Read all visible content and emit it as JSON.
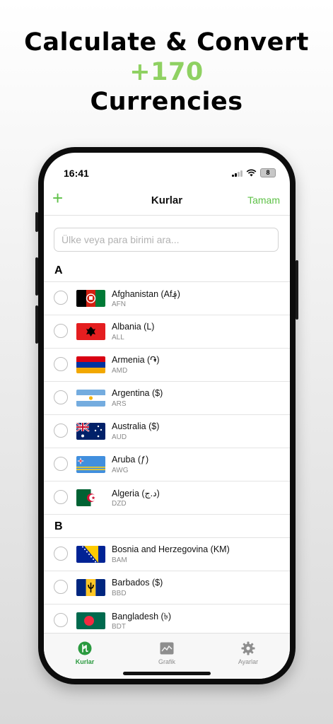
{
  "promo": {
    "line1": "Calculate & Convert",
    "line2": "+170",
    "line3": "Currencies"
  },
  "status": {
    "time": "16:41",
    "battery": "8"
  },
  "nav": {
    "add": "+",
    "title": "Kurlar",
    "done": "Tamam"
  },
  "search": {
    "placeholder": "Ülke veya para birimi ara..."
  },
  "sections": [
    {
      "letter": "A",
      "items": [
        {
          "name": "Afghanistan (Af؋)",
          "code": "AFN",
          "flag": "afghanistan-flag-icon"
        },
        {
          "name": "Albania (L)",
          "code": "ALL",
          "flag": "albania-flag-icon"
        },
        {
          "name": "Armenia (֏)",
          "code": "AMD",
          "flag": "armenia-flag-icon"
        },
        {
          "name": "Argentina ($)",
          "code": "ARS",
          "flag": "argentina-flag-icon"
        },
        {
          "name": "Australia ($)",
          "code": "AUD",
          "flag": "australia-flag-icon"
        },
        {
          "name": "Aruba (ƒ)",
          "code": "AWG",
          "flag": "aruba-flag-icon"
        },
        {
          "name": "Algeria (د.ج)",
          "code": "DZD",
          "flag": "algeria-flag-icon"
        }
      ]
    },
    {
      "letter": "B",
      "items": [
        {
          "name": "Bosnia and Herzegovina (KM)",
          "code": "BAM",
          "flag": "bosnia-flag-icon"
        },
        {
          "name": "Barbados ($)",
          "code": "BBD",
          "flag": "barbados-flag-icon"
        },
        {
          "name": "Bangladesh (৳)",
          "code": "BDT",
          "flag": "bangladesh-flag-icon"
        }
      ]
    }
  ],
  "tabs": [
    {
      "label": "Kurlar",
      "icon": "currency-icon",
      "active": true
    },
    {
      "label": "Grafik",
      "icon": "chart-icon",
      "active": false
    },
    {
      "label": "Ayarlar",
      "icon": "gear-icon",
      "active": false
    }
  ],
  "colors": {
    "accent": "#5ec147",
    "promo_highlight": "#8fd162",
    "active_tab": "#2a9a3f"
  }
}
